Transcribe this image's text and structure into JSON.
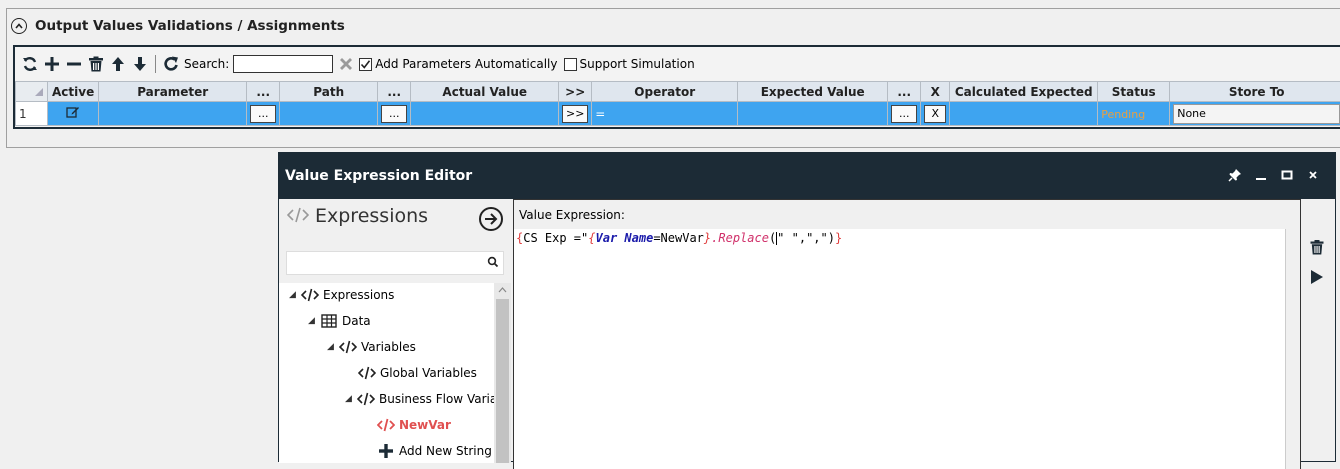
{
  "section": {
    "title": "Output Values Validations / Assignments"
  },
  "toolbar": {
    "search_label": "Search:",
    "search_value": "",
    "add_params_label": "Add Parameters Automatically",
    "add_params_checked": true,
    "support_sim_label": "Support Simulation",
    "support_sim_checked": false
  },
  "grid": {
    "columns": [
      "Active",
      "Parameter",
      "...",
      "Path",
      "...",
      "Actual Value",
      ">>",
      "Operator",
      "Expected Value",
      "...",
      "X",
      "Calculated Expected",
      "Status",
      "Store To"
    ],
    "row": {
      "index": "1",
      "btn_dots": "...",
      "btn_arrows": ">>",
      "operator": "=",
      "btn_x": "X",
      "status": "Pending",
      "store_to": "None"
    }
  },
  "dialog": {
    "title": "Value Expression Editor",
    "expressions_title": "Expressions",
    "value_expression_label": "Value Expression:",
    "tree": [
      {
        "label": "Expressions",
        "icon": "code-icon"
      },
      {
        "label": "Data",
        "icon": "table-icon"
      },
      {
        "label": "Variables",
        "icon": "code-icon"
      },
      {
        "label": "Global Variables",
        "icon": "code-icon"
      },
      {
        "label": "Business Flow Variabl",
        "icon": "code-icon"
      },
      {
        "label": "NewVar",
        "icon": "code-icon"
      },
      {
        "label": "Add New String V",
        "icon": "plus-icon"
      }
    ],
    "expression": {
      "open": "{",
      "cs": "CS Exp =\"",
      "brace_open": "{",
      "var_kw": "Var",
      "name_kw": "Name",
      "name_val": "=NewVar",
      "brace_close": "}",
      "method": ".Replace",
      "paren_open": "(",
      "args": "\" \",\",\")",
      "close": "}"
    }
  },
  "colors": {
    "selected_row": "#3ea4f0",
    "title_bar": "#1c2b36",
    "status_pending": "#e8a040",
    "new_var": "#e05050"
  }
}
